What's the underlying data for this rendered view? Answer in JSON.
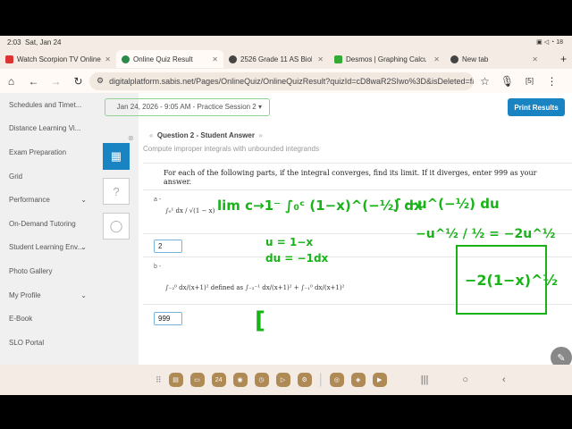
{
  "status": {
    "time": "2:03",
    "date": "Sat, Jan 24",
    "battery": "18"
  },
  "tabs": [
    {
      "label": "Watch Scorpion TV Online",
      "color": "#d33"
    },
    {
      "label": "Online Quiz Result",
      "color": "#2a8a4a",
      "active": true
    },
    {
      "label": "2526 Grade 11 AS Biology",
      "color": "#444"
    },
    {
      "label": "Desmos | Graphing Calculat",
      "color": "#3a3"
    },
    {
      "label": "New tab",
      "color": "#444"
    }
  ],
  "address": {
    "url": "digitalplatform.sabis.net/Pages/OnlineQuiz/OnlineQuizResult?quizId=cD8waR2SIwo%3D&isDeleted=false&",
    "tab_count": "5"
  },
  "sidebar": {
    "items": [
      {
        "label": "Schedules and Timet..."
      },
      {
        "label": "Distance Learning Vi..."
      },
      {
        "label": "Exam Preparation"
      },
      {
        "label": "Grid"
      },
      {
        "label": "Performance",
        "chevron": true
      },
      {
        "label": "On-Demand Tutoring"
      },
      {
        "label": "Student Learning Env...",
        "chevron": true
      },
      {
        "label": "Photo Gallery"
      },
      {
        "label": "My Profile",
        "chevron": true
      },
      {
        "label": "E-Book"
      },
      {
        "label": "SLO Portal"
      }
    ]
  },
  "main": {
    "session_select": "Jan 24, 2026 - 9:05 AM - Practice Session 2 ▾",
    "print_label": "Print Results",
    "question_title": "Question 2 - Student Answer",
    "subtitle": "Compute improper integrals with unbounded integrands",
    "prompt": "For each of the following parts, if the integral converges, find its limit. If it diverges, enter 999 as your answer.",
    "parts": [
      {
        "label": "a -",
        "expr": "∫₀¹ dx / √(1 − x)",
        "answer": "2"
      },
      {
        "label": "b -",
        "expr": "∫₋₂⁰ dx/(x+1)²  defined as  ∫₋₂⁻¹ dx/(x+1)² + ∫₋₁⁰ dx/(x+1)²",
        "answer": "999"
      }
    ]
  },
  "handwriting": {
    "lim": "lim c→1⁻ ∫₀ᶜ (1−x)^(−½) dx",
    "sub1": "u = 1−x",
    "sub2": "du = −1dx",
    "int": "∫ −u^(−½) du",
    "step": "−u^½ / ½  =  −2u^½",
    "boxed": "−2(1−x)^½",
    "bracket": "["
  },
  "taskbar": {
    "calendar_day": "24"
  }
}
